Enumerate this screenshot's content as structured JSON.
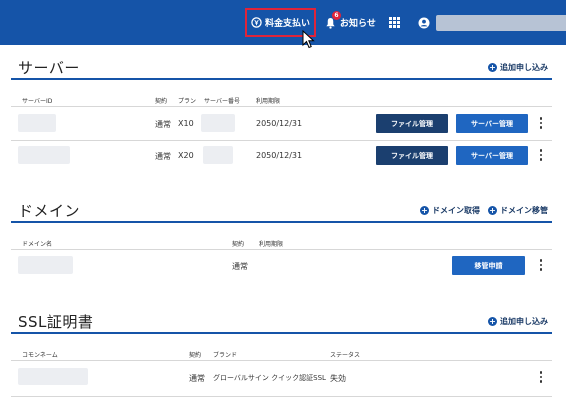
{
  "header": {
    "pay_label": "料金支払い",
    "news_label": "お知らせ",
    "news_badge": "6",
    "icons": {
      "pay": "yen-coin-icon",
      "news": "bell-icon",
      "apps": "grid-icon",
      "account": "user-circle-icon"
    }
  },
  "server": {
    "title": "サーバー",
    "add_label": "追加申し込み",
    "columns": {
      "id": "サーバーID",
      "contract": "契約",
      "plan": "プラン",
      "number": "サーバー番号",
      "expiry": "利用期限"
    },
    "rows": [
      {
        "contract": "通常",
        "plan": "X10",
        "expiry": "2050/12/31",
        "file_label": "ファイル管理",
        "server_label": "サーバー管理"
      },
      {
        "contract": "通常",
        "plan": "X20",
        "expiry": "2050/12/31",
        "file_label": "ファイル管理",
        "server_label": "サーバー管理"
      }
    ]
  },
  "domain": {
    "title": "ドメイン",
    "acquire_label": "ドメイン取得",
    "transfer_label": "ドメイン移管",
    "columns": {
      "name": "ドメイン名",
      "contract": "契約",
      "expiry": "利用期限"
    },
    "rows": [
      {
        "contract": "通常",
        "transfer_apply_label": "移管申請"
      }
    ]
  },
  "ssl": {
    "title": "SSL証明書",
    "add_label": "追加申し込み",
    "columns": {
      "common_name": "コモンネーム",
      "contract": "契約",
      "brand": "ブランド",
      "status": "ステータス"
    },
    "rows": [
      {
        "contract": "通常",
        "brand": "グローバルサイン クイック認証SSL",
        "status": "失効"
      }
    ]
  },
  "colors": {
    "header_bg": "#1554a8",
    "highlight": "#e0243a",
    "button_dark": "#1b3f6f",
    "button_blue": "#1f66c1"
  }
}
